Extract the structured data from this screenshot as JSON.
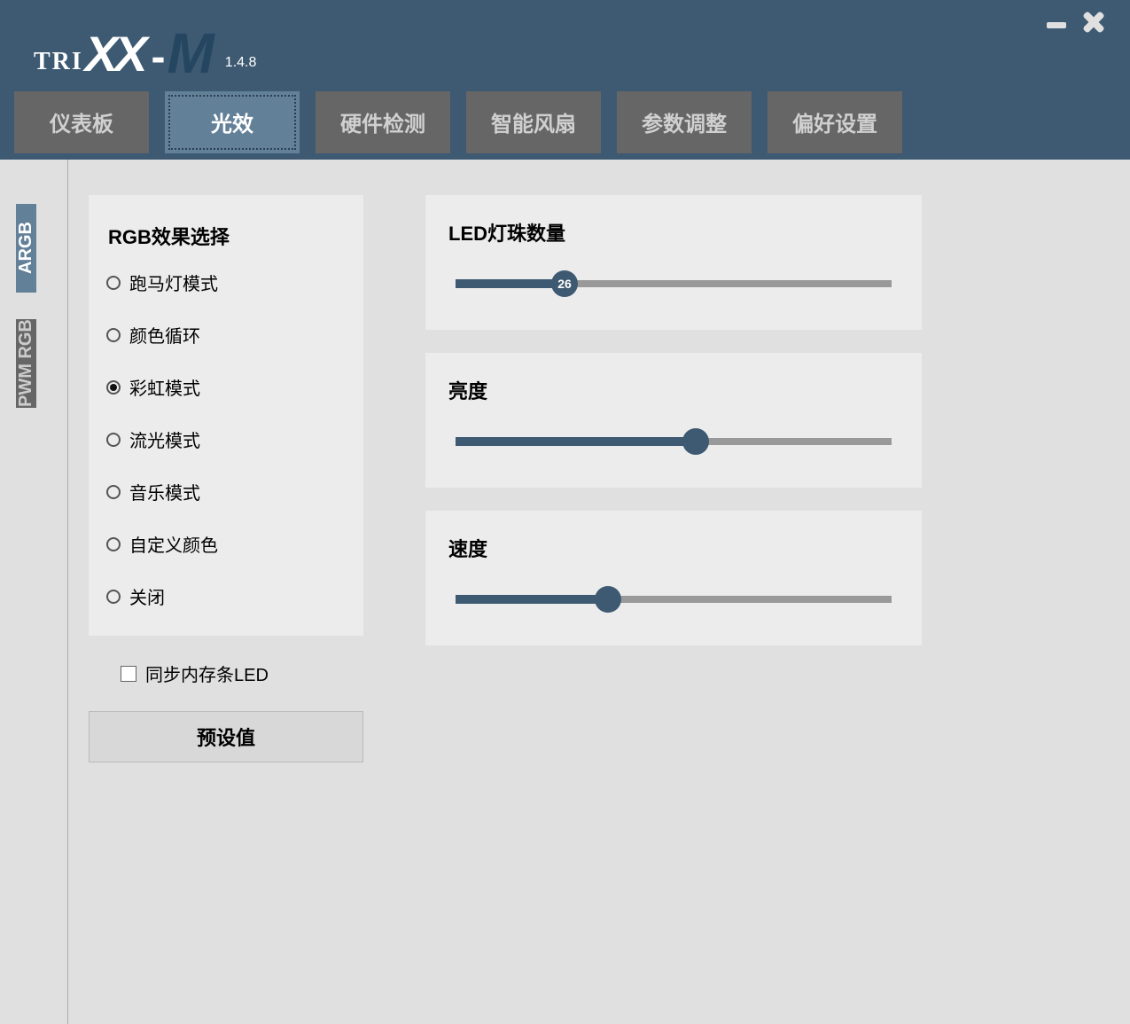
{
  "app": {
    "logo_tri": "TRI",
    "logo_xx": "XX",
    "logo_dash": "-",
    "logo_m": "M",
    "version": "1.4.8"
  },
  "tabs": [
    {
      "label": "仪表板",
      "active": false
    },
    {
      "label": "光效",
      "active": true
    },
    {
      "label": "硬件检测",
      "active": false
    },
    {
      "label": "智能风扇",
      "active": false
    },
    {
      "label": "参数调整",
      "active": false
    },
    {
      "label": "偏好设置",
      "active": false
    }
  ],
  "side_tabs": [
    {
      "label": "ARGB",
      "active": true
    },
    {
      "label": "PWM RGB",
      "active": false
    }
  ],
  "rgb_panel": {
    "title": "RGB效果选择",
    "options": [
      {
        "label": "跑马灯模式",
        "selected": false
      },
      {
        "label": "颜色循环",
        "selected": false
      },
      {
        "label": "彩虹模式",
        "selected": true
      },
      {
        "label": "流光模式",
        "selected": false
      },
      {
        "label": "音乐模式",
        "selected": false
      },
      {
        "label": "自定义颜色",
        "selected": false
      },
      {
        "label": "关闭",
        "selected": false
      }
    ]
  },
  "sync": {
    "label": "同步内存条LED",
    "checked": false
  },
  "preset_btn": "预设值",
  "sliders": [
    {
      "title": "LED灯珠数量",
      "value": 26,
      "show_value": true,
      "percent": 25
    },
    {
      "title": "亮度",
      "show_value": false,
      "percent": 55
    },
    {
      "title": "速度",
      "show_value": false,
      "percent": 35
    }
  ]
}
